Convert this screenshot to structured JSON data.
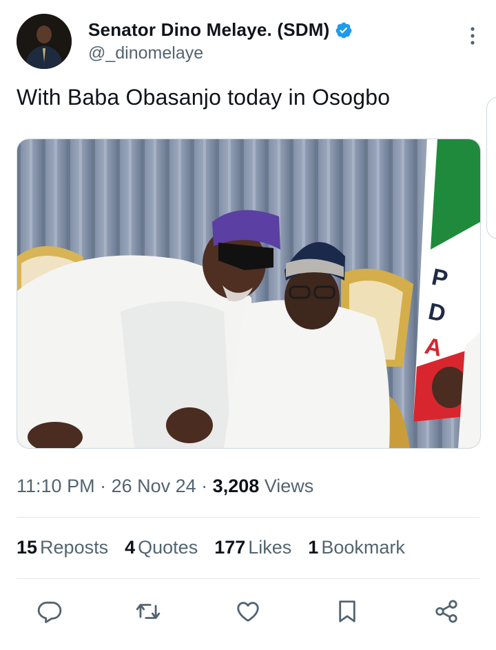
{
  "author": {
    "display_name": "Senator Dino Melaye. (SDM)",
    "handle": "@_dinomelaye",
    "verified": true,
    "verified_color": "#1d9bf0"
  },
  "tweet": {
    "text": "With Baba Obasanjo today in Osogbo"
  },
  "meta": {
    "time": "11:10 PM",
    "separator1": " · ",
    "date": "26 Nov 24",
    "separator2": " · ",
    "views_count": "3,208",
    "views_label": " Views"
  },
  "stats": [
    {
      "num": "15",
      "label": "Reposts"
    },
    {
      "num": "4",
      "label": "Quotes"
    },
    {
      "num": "177",
      "label": "Likes"
    },
    {
      "num": "1",
      "label": "Bookmark"
    }
  ],
  "actions": {
    "reply": "reply-icon",
    "repost": "repost-icon",
    "like": "heart-icon",
    "bookmark": "bookmark-icon",
    "share": "share-icon"
  },
  "colors": {
    "text_primary": "#0f1419",
    "text_secondary": "#536471",
    "icon": "#536471"
  }
}
